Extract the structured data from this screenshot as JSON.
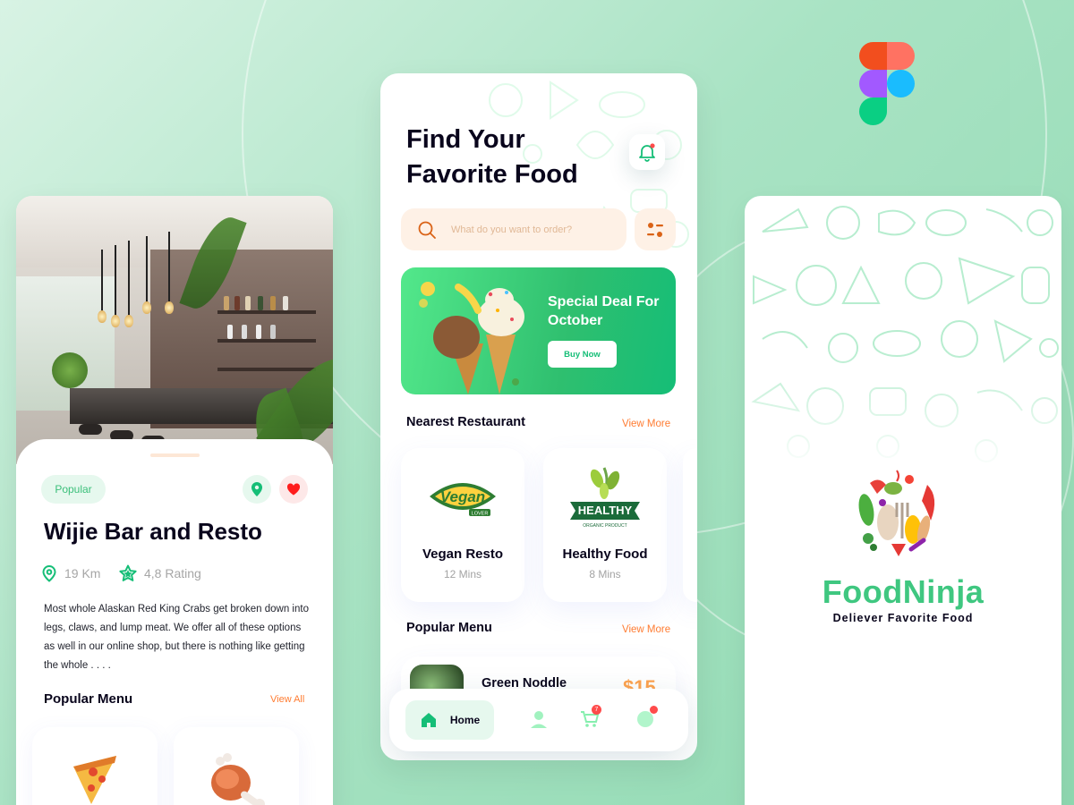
{
  "detail_screen": {
    "tag": "Popular",
    "title": "Wijie Bar and Resto",
    "distance": "19 Km",
    "rating": "4,8 Rating",
    "description": "Most whole Alaskan Red King Crabs get broken down into legs, claws, and lump meat. We offer all of these options as well in our online shop, but there is nothing like getting the whole . . . .",
    "popular_menu_title": "Popular Menu",
    "view_all": "View All",
    "food_icons": [
      "pizza-icon",
      "meat-icon"
    ]
  },
  "home_screen": {
    "title_line1": "Find Your",
    "title_line2": "Favorite Food",
    "search_placeholder": "What do you want to order?",
    "promo": {
      "title": "Special Deal For October",
      "button": "Buy Now"
    },
    "nearest_title": "Nearest Restaurant",
    "nearest_view_more": "View More",
    "restaurants": [
      {
        "name": "Vegan Resto",
        "time": "12 Mins",
        "logo_text": "Vegan",
        "logo_sub": "LOVER"
      },
      {
        "name": "Healthy Food",
        "time": "8 Mins",
        "logo_text": "HEALTHY",
        "logo_sub": "ORGANIC PRODUCT"
      }
    ],
    "popular_title": "Popular Menu",
    "popular_view_more": "View More",
    "menu_item": {
      "name": "Green Noddle",
      "price": "$15"
    },
    "nav": {
      "home_label": "Home",
      "cart_badge": "7"
    }
  },
  "splash_screen": {
    "brand": "FoodNinja",
    "tagline": "Deliever Favorite Food"
  },
  "colors": {
    "accent_green": "#15BE77",
    "orange": "#FF7C32",
    "dark": "#09051C"
  }
}
